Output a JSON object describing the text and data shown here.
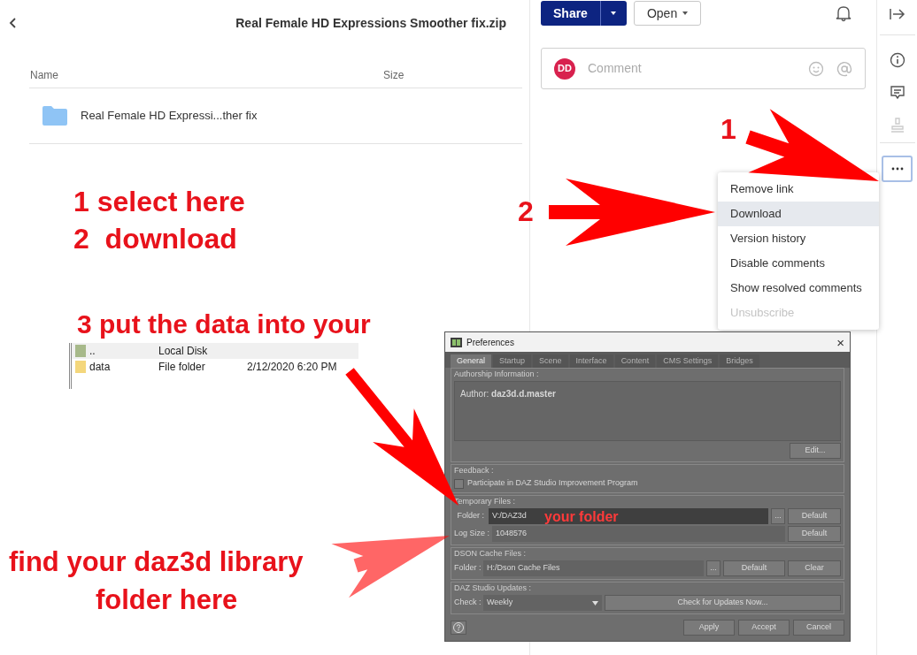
{
  "header": {
    "title": "Real Female HD Expressions Smoother fix.zip"
  },
  "file_list": {
    "columns": [
      "Name",
      "Size"
    ],
    "rows": [
      {
        "name": "Real Female HD Expressi...ther fix"
      }
    ]
  },
  "toolbar": {
    "share": "Share",
    "open": "Open"
  },
  "comment": {
    "avatar": "DD",
    "placeholder": "Comment"
  },
  "menu": [
    {
      "label": "Remove link",
      "selected": false,
      "disabled": false
    },
    {
      "label": "Download",
      "selected": true,
      "disabled": false
    },
    {
      "label": "Version history",
      "selected": false,
      "disabled": false
    },
    {
      "label": "Disable comments",
      "selected": false,
      "disabled": false
    },
    {
      "label": "Show resolved comments",
      "selected": false,
      "disabled": false
    },
    {
      "label": "Unsubscribe",
      "selected": false,
      "disabled": true
    }
  ],
  "explorer": [
    {
      "name": "..",
      "type": "Local Disk",
      "kind": "drive"
    },
    {
      "name": "data",
      "type": "File folder",
      "date": "2/12/2020 6:20 PM",
      "kind": "folder"
    }
  ],
  "preferences": {
    "title": "Preferences",
    "close": "×",
    "tabs": [
      {
        "label": "General",
        "selected": true
      },
      {
        "label": "Startup",
        "selected": false
      },
      {
        "label": "Scene",
        "selected": false
      },
      {
        "label": "Interface",
        "selected": false
      },
      {
        "label": "Content",
        "selected": false
      },
      {
        "label": "CMS Settings",
        "selected": false
      },
      {
        "label": "Bridges",
        "selected": false
      }
    ],
    "authorship": {
      "label": "Authorship Information :",
      "author": "Author: **daz3d.d.master**",
      "edit": "Edit..."
    },
    "feedback": {
      "label": "Feedback :",
      "checkbox": "Participate in DAZ Studio Improvement Program",
      "checked": false
    },
    "temp": {
      "label": "Temporary Files :",
      "folder_label": "Folder :",
      "folder": "V:/DAZ3d",
      "browse": "...",
      "default": "Default",
      "log_label": "Log Size :",
      "log": "1048576",
      "log_default": "Default"
    },
    "dson": {
      "label": "DSON Cache Files :",
      "folder_label": "Folder :",
      "folder": "H:/Dson Cache Files",
      "browse": "...",
      "default": "Default",
      "clear": "Clear"
    },
    "updates": {
      "label": "DAZ Studio Updates :",
      "check_label": "Check :",
      "check": "Weekly",
      "button": "Check for Updates Now..."
    },
    "footer": [
      "Apply",
      "Accept",
      "Cancel"
    ]
  },
  "annotations": [
    {
      "text": "1 select here"
    },
    {
      "text": "2  download"
    },
    {
      "text": "3 put the data into your"
    },
    {
      "text": "find your daz3d library"
    },
    {
      "text": "folder here"
    },
    {
      "text": "1"
    },
    {
      "text": "2"
    },
    {
      "text": "your folder"
    }
  ]
}
